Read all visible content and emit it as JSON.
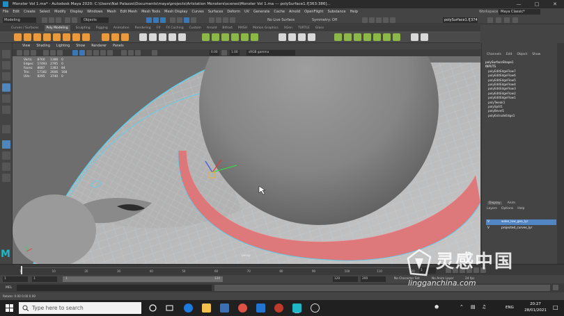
{
  "window": {
    "title": "Monster Vol 1.ma* - Autodesk Maya 2020: C:\\Users\\Nat Palazzo\\Documents\\maya\\projects\\Artstation Monsters\\scenes\\Monster Vol 1.ma  ---  polySurface1.f[363:386]...",
    "minimize": "—",
    "maximize": "□",
    "close": "✕"
  },
  "menubar": {
    "items": [
      "File",
      "Edit",
      "Create",
      "Select",
      "Modify",
      "Display",
      "Windows",
      "Mesh",
      "Edit Mesh",
      "Mesh Tools",
      "Mesh Display",
      "Curves",
      "Surfaces",
      "Deform",
      "UV",
      "Generate",
      "Cache",
      "Arnold",
      "OpenFlight",
      "Substance",
      "Help"
    ],
    "workspace_label": "Workspace :",
    "workspace_value": "Maya Classic*"
  },
  "statusline": {
    "mode": "Modeling",
    "objects": "Objects",
    "live_surface": "No Live Surface",
    "symmetry": "Symmetry: Off",
    "field": "polySurface1.f[374]"
  },
  "shelf_tabs": [
    "Curves / Surfaces",
    "Poly Modeling",
    "Sculpting",
    "Rigging",
    "Animation",
    "Rendering",
    "FX",
    "FX Caching",
    "Custom",
    "Arnold",
    "Bifrost",
    "MASH",
    "Motion Graphics",
    "XGen",
    "TURTLE",
    "Glass"
  ],
  "shelf_active": "Poly Modeling",
  "viewport": {
    "menu": [
      "View",
      "Shading",
      "Lighting",
      "Show",
      "Renderer",
      "Panels"
    ],
    "toolbar_value_a": "0.00",
    "toolbar_value_b": "1.00",
    "colorspace": "sRGB gamma",
    "camera_label": "persp",
    "hud": {
      "headers": [
        "",
        "",
        "",
        ""
      ],
      "rows": [
        [
          "Verts:",
          "8760",
          "1388",
          "0"
        ],
        [
          "Edges:",
          "17493",
          "2795",
          "0"
        ],
        [
          "Faces:",
          "8687",
          "1383",
          "84"
        ],
        [
          "Tris:",
          "17182",
          "2606",
          "168"
        ],
        [
          "UVs:",
          "8295",
          "3740",
          "0"
        ]
      ]
    }
  },
  "channel_box": {
    "menu": [
      "Channels",
      "Edit",
      "Object",
      "Show"
    ],
    "node": "polySurfaceShape1",
    "inputs_label": "INPUTS",
    "inputs": [
      "polyEditEdgeFlow7",
      "polyEditEdgeFlow6",
      "polyEditEdgeFlow5",
      "polyEditEdgeFlow4",
      "polyEditEdgeFlow3",
      "polyEditEdgeFlow2",
      "polyEditEdgeFlow1",
      "polyTweak1",
      "polySplit1",
      "polyBevel1",
      "polyExtrudeEdge1"
    ]
  },
  "layers": {
    "tabs": [
      "Display",
      "Anim"
    ],
    "menu": [
      "Layers",
      "Options",
      "Help"
    ],
    "items": [
      {
        "flags": "V",
        "name": "wake_low_geo_lyr",
        "selected": true
      },
      {
        "flags": "V",
        "name": "projected_curves_lyr",
        "selected": false
      }
    ]
  },
  "timeline": {
    "ticks": [
      "1",
      "10",
      "20",
      "30",
      "40",
      "50",
      "60",
      "70",
      "80",
      "90",
      "100",
      "110",
      "120"
    ],
    "current_frame": "1"
  },
  "range_slider": {
    "start": "1",
    "start_inner": "1",
    "range_start_marker": "1",
    "end_inner": "120",
    "end": "120",
    "max": "200",
    "character_set": "No Character Set",
    "anim_layer": "No Anim Layer",
    "fps": "24 fps"
  },
  "cmdline": {
    "lang": "MEL"
  },
  "helpline": {
    "text": "Rotate: 0.00   0.00   0.00"
  },
  "taskbar": {
    "search_placeholder": "Type here to search",
    "language": "ENG",
    "time": "20:27",
    "date": "28/01/2021"
  },
  "watermark": {
    "cn": "灵感中国",
    "url": "lingganchina.com"
  },
  "colors": {
    "accent": "#5285c4",
    "wireframe": "#5ad1ef",
    "selection": "#e46a6f",
    "maya_logo": "#1fb7c7"
  }
}
